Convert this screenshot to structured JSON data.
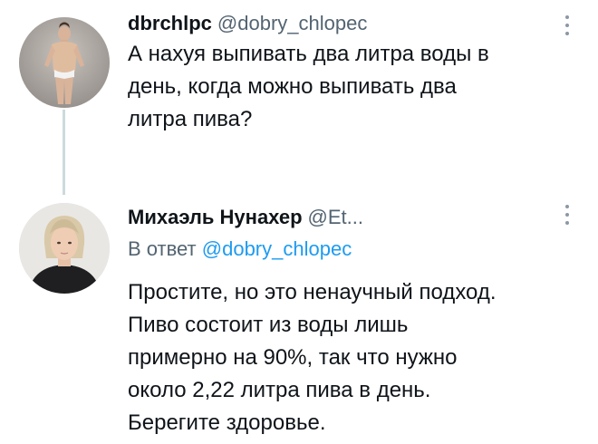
{
  "tweets": [
    {
      "name": "dbrchlpc",
      "handle": "@dobry_chlopec",
      "text_lines": [
        "А нахуя выпивать два литра воды в",
        "день, когда можно выпивать два",
        "литра пива?"
      ]
    },
    {
      "name": "Михаэль Нунахер",
      "handle": "@Et...",
      "reply_prefix": "В ответ",
      "reply_mention": "@dobry_chlopec",
      "text_lines": [
        "Простите, но это ненаучный подход.",
        "Пиво состоит из воды лишь",
        "примерно на 90%, так что нужно",
        "около 2,22 литра пива в день.",
        "Берегите здоровье."
      ]
    }
  ],
  "icons": {
    "more": "more-vertical-icon"
  },
  "colors": {
    "text": "#0f1419",
    "secondary": "#536471",
    "mention": "#1d9bf0",
    "thread_line": "#cfd9de"
  }
}
